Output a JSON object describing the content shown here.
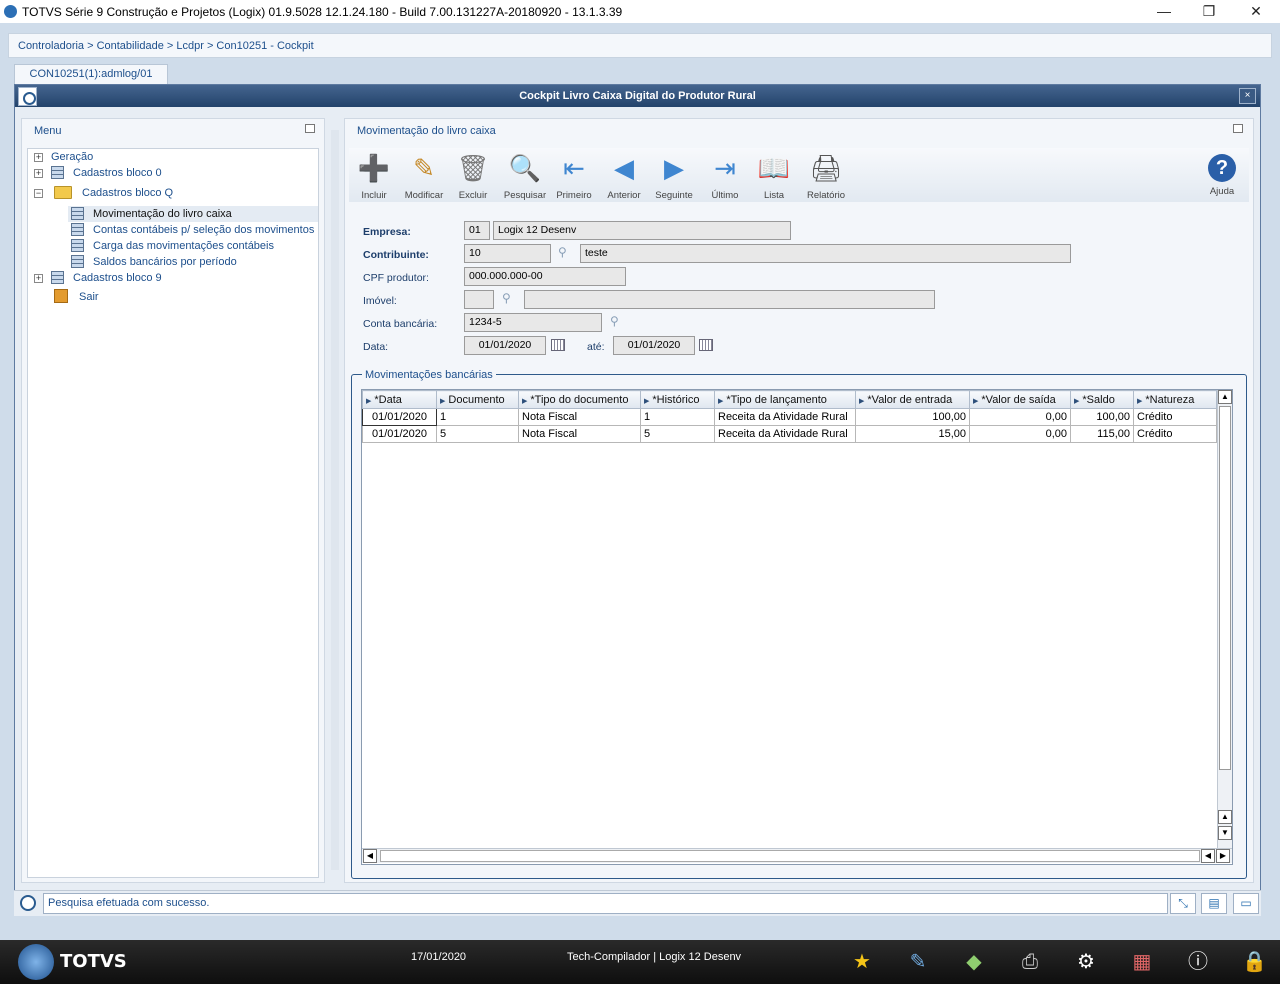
{
  "window": {
    "title": "TOTVS Série 9 Construção e Projetos (Logix) 01.9.5028   12.1.24.180 - Build 7.00.131227A-20180920 - 13.1.3.39",
    "minimize": "—",
    "maximize": "❐",
    "close": "✕"
  },
  "breadcrumb": "Controladoria > Contabilidade > Lcdpr > Con10251 - Cockpit",
  "tab_label": "CON10251(1):admlog/01",
  "dialog": {
    "title": "Cockpit Livro Caixa Digital do Produtor Rural",
    "close": "×"
  },
  "menu": {
    "title": "Menu",
    "items": [
      {
        "label": "Geração"
      },
      {
        "label": "Cadastros bloco 0"
      },
      {
        "label": "Cadastros bloco Q"
      },
      {
        "label": "Movimentação do livro caixa"
      },
      {
        "label": "Contas contábeis p/ seleção dos movimentos"
      },
      {
        "label": "Carga das movimentações contábeis"
      },
      {
        "label": "Saldos bancários por período"
      },
      {
        "label": "Cadastros bloco 9"
      },
      {
        "label": "Sair"
      }
    ]
  },
  "main": {
    "title": "Movimentação do livro caixa",
    "toolbar": [
      {
        "label": "Incluir",
        "icon": "add-icon",
        "glyph": "➕"
      },
      {
        "label": "Modificar",
        "icon": "edit-icon",
        "glyph": "✎"
      },
      {
        "label": "Excluir",
        "icon": "trash-icon",
        "glyph": "🗑"
      },
      {
        "label": "Pesquisar",
        "icon": "search-icon",
        "glyph": "🔍"
      },
      {
        "label": "Primeiro",
        "icon": "first-icon",
        "glyph": "⇤"
      },
      {
        "label": "Anterior",
        "icon": "previous-icon",
        "glyph": "◀"
      },
      {
        "label": "Seguinte",
        "icon": "next-icon",
        "glyph": "▶"
      },
      {
        "label": "Último",
        "icon": "last-icon",
        "glyph": "⇥"
      },
      {
        "label": "Lista",
        "icon": "book-icon",
        "glyph": "📖"
      },
      {
        "label": "Relatório",
        "icon": "printer-icon",
        "glyph": "🖨"
      },
      {
        "label": "Ajuda",
        "icon": "help-icon",
        "glyph": "?"
      }
    ],
    "form": {
      "empresa_label": "Empresa:",
      "empresa_code": "01",
      "empresa_name": "Logix 12 Desenv",
      "contribuinte_label": "Contribuinte:",
      "contribuinte_code": "10",
      "contribuinte_name": "teste",
      "cpf_label": "CPF produtor:",
      "cpf_value": "000.000.000-00",
      "imovel_label": "Imóvel:",
      "imovel_code": "",
      "imovel_name": "",
      "conta_label": "Conta bancária:",
      "conta_value": "1234-5",
      "data_label": "Data:",
      "data_from": "01/01/2020",
      "ate_label": "até:",
      "data_to": "01/01/2020"
    },
    "group_title": "Movimentações bancárias",
    "grid": {
      "columns": [
        "*Data",
        "Documento",
        "*Tipo do documento",
        "*Histórico",
        "*Tipo de lançamento",
        "*Valor de entrada",
        "*Valor de saída",
        "*Saldo",
        "*Natureza"
      ],
      "rows": [
        [
          "01/01/2020",
          "1",
          "Nota Fiscal",
          "1",
          "Receita da Atividade Rural",
          "100,00",
          "0,00",
          "100,00",
          "Crédito"
        ],
        [
          "01/01/2020",
          "5",
          "Nota Fiscal",
          "5",
          "Receita da Atividade Rural",
          "15,00",
          "0,00",
          "115,00",
          "Crédito"
        ]
      ]
    }
  },
  "status": {
    "message": "Pesquisa efetuada com sucesso."
  },
  "taskbar": {
    "brand": "TOTVS",
    "date": "17/01/2020",
    "info": "Tech-Compilador | Logix 12 Desenv"
  }
}
